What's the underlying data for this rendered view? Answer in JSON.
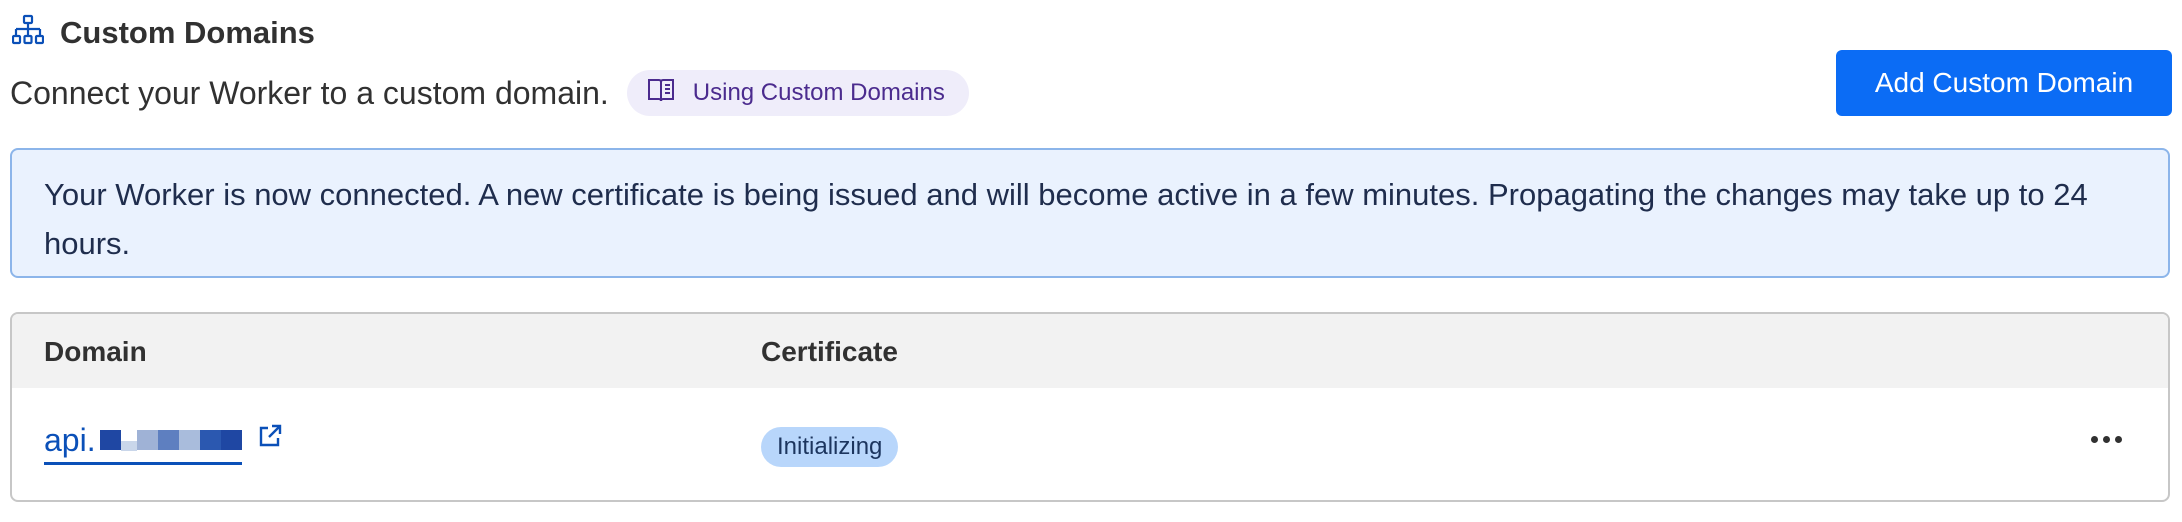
{
  "header": {
    "icon": "sitemap-icon",
    "title": "Custom Domains"
  },
  "description": "Connect your Worker to a custom domain.",
  "docs_link": {
    "icon": "book-icon",
    "label": "Using Custom Domains"
  },
  "add_button": {
    "label": "Add Custom Domain"
  },
  "banner": {
    "message": "Your Worker is now connected. A new certificate is being issued and will become active in a few minutes. Propagating the changes may take up to 24 hours."
  },
  "table": {
    "columns": [
      "Domain",
      "Certificate"
    ],
    "rows": [
      {
        "domain": "api.",
        "domain_icon": "external-link-icon",
        "certificate_status": "Initializing",
        "actions_icon": "more-horizontal-icon"
      }
    ]
  },
  "colors": {
    "accent": "#0b6cf5",
    "link": "#0b50b8",
    "banner_bg": "#eaf2fe",
    "banner_border": "#8cb5ea",
    "badge_bg": "#b8d6fb",
    "pill_bg": "#efedfa"
  }
}
